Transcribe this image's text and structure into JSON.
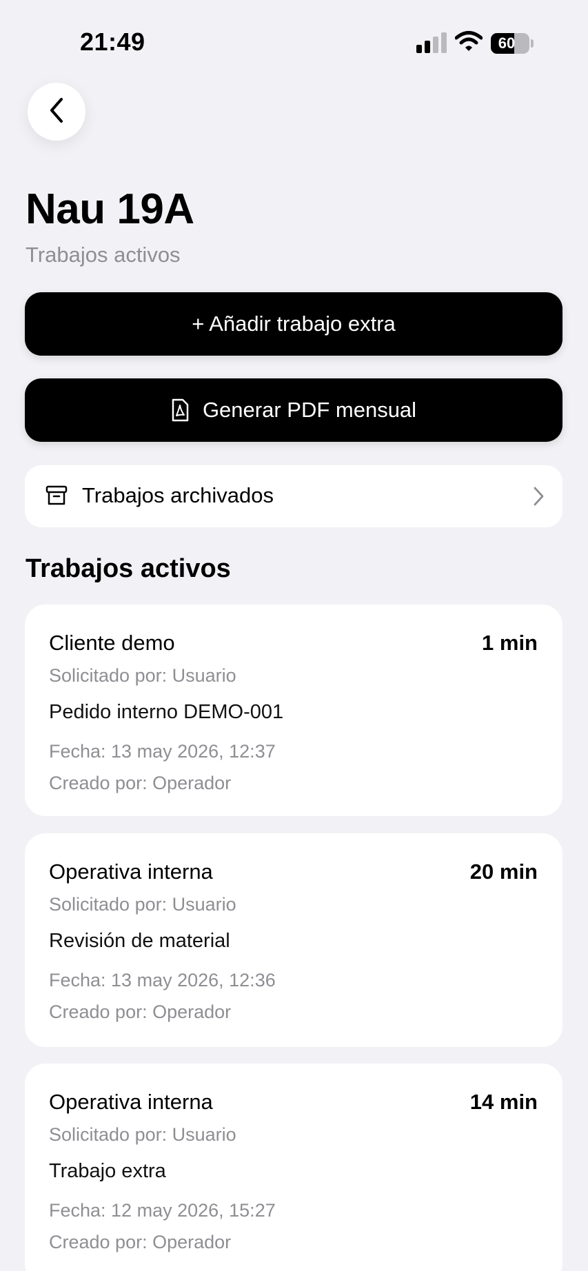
{
  "status_bar": {
    "time": "21:49",
    "battery_percent": "60",
    "battery_level": 0.6,
    "signal_bars_active": 2,
    "signal_bars_total": 4
  },
  "header": {
    "back_icon": "chevron-left-icon",
    "title": "Nau 19A",
    "subtitle": "Trabajos activos"
  },
  "actions": {
    "add_extra_label": "+ Añadir trabajo extra",
    "pdf_label": "Generar PDF mensual",
    "pdf_icon": "pdf-file-icon"
  },
  "archived": {
    "label": "Trabajos archivados",
    "icon": "archive-box-icon"
  },
  "section": {
    "title": "Trabajos activos"
  },
  "jobs": [
    {
      "client": "Cliente demo",
      "duration": "1 min",
      "requested_by": "Solicitado por: Usuario",
      "description": "Pedido interno DEMO-001",
      "date": "Fecha: 13 may 2026, 12:37",
      "created_by": "Creado por: Operador"
    },
    {
      "client": "Operativa interna",
      "duration": "20 min",
      "requested_by": "Solicitado por: Usuario",
      "description": "Revisión de material",
      "date": "Fecha: 13 may 2026, 12:36",
      "created_by": "Creado por: Operador"
    },
    {
      "client": "Operativa interna",
      "duration": "14 min",
      "requested_by": "Solicitado por: Usuario",
      "description": "Trabajo extra",
      "date": "Fecha: 12 may 2026, 15:27",
      "created_by": "Creado por: Operador"
    }
  ],
  "colors": {
    "background": "#f2f2f6",
    "card": "#ffffff",
    "primary": "#000000",
    "secondary_text": "#8e8e93"
  }
}
